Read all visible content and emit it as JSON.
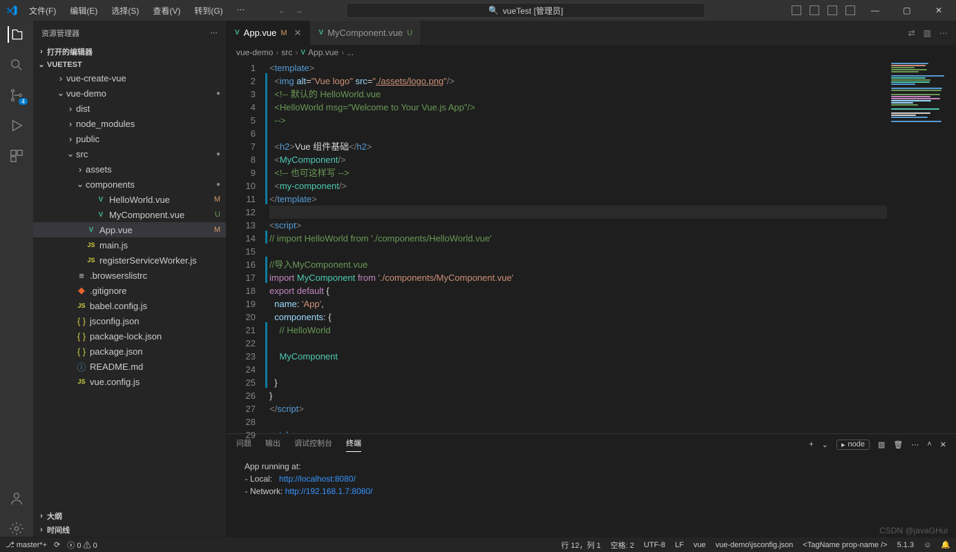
{
  "menus": [
    "文件(F)",
    "编辑(E)",
    "选择(S)",
    "查看(V)",
    "转到(G)"
  ],
  "search": {
    "text": "vueTest [管理员]"
  },
  "sidebar": {
    "title": "资源管理器",
    "openEditors": "打开的编辑器",
    "project": "VUETEST",
    "outline": "大纲",
    "timeline": "时间线",
    "tree": [
      {
        "ind": 2,
        "chev": "›",
        "type": "folder",
        "label": "vue-create-vue"
      },
      {
        "ind": 2,
        "chev": "⌄",
        "type": "folder",
        "label": "vue-demo",
        "dot": true
      },
      {
        "ind": 3,
        "chev": "›",
        "type": "folder",
        "label": "dist"
      },
      {
        "ind": 3,
        "chev": "›",
        "type": "folder",
        "label": "node_modules"
      },
      {
        "ind": 3,
        "chev": "›",
        "type": "folder",
        "label": "public"
      },
      {
        "ind": 3,
        "chev": "⌄",
        "type": "folder",
        "label": "src",
        "dot": true
      },
      {
        "ind": 4,
        "chev": "›",
        "type": "folder",
        "label": "assets"
      },
      {
        "ind": 4,
        "chev": "⌄",
        "type": "folder",
        "label": "components",
        "dot": true
      },
      {
        "ind": 5,
        "type": "vue",
        "label": "HelloWorld.vue",
        "badge": "M"
      },
      {
        "ind": 5,
        "type": "vue",
        "label": "MyComponent.vue",
        "badge": "U"
      },
      {
        "ind": 4,
        "type": "vue",
        "label": "App.vue",
        "badge": "M",
        "sel": true
      },
      {
        "ind": 4,
        "type": "js",
        "label": "main.js"
      },
      {
        "ind": 4,
        "type": "js",
        "label": "registerServiceWorker.js"
      },
      {
        "ind": 3,
        "type": "file",
        "label": ".browserslistrc"
      },
      {
        "ind": 3,
        "type": "git",
        "label": ".gitignore"
      },
      {
        "ind": 3,
        "type": "js",
        "label": "babel.config.js"
      },
      {
        "ind": 3,
        "type": "json",
        "label": "jsconfig.json"
      },
      {
        "ind": 3,
        "type": "json",
        "label": "package-lock.json"
      },
      {
        "ind": 3,
        "type": "json",
        "label": "package.json"
      },
      {
        "ind": 3,
        "type": "md",
        "label": "README.md"
      },
      {
        "ind": 3,
        "type": "js",
        "label": "vue.config.js"
      }
    ]
  },
  "tabs": [
    {
      "icon": "vue",
      "label": "App.vue",
      "mod": "M",
      "active": true,
      "close": true
    },
    {
      "icon": "vue",
      "label": "MyComponent.vue",
      "mod": "U"
    }
  ],
  "breadcrumb": [
    "vue-demo",
    "src",
    "App.vue",
    "..."
  ],
  "sc": {
    "badge": "4"
  },
  "code": {
    "lines": [
      1,
      2,
      3,
      4,
      5,
      6,
      7,
      8,
      9,
      10,
      11,
      12,
      13,
      14,
      15,
      16,
      17,
      18,
      19,
      20,
      21,
      22,
      23,
      24,
      25,
      26,
      27,
      28,
      29
    ],
    "mods": [
      0,
      1,
      1,
      1,
      1,
      1,
      1,
      1,
      1,
      1,
      1,
      0,
      0,
      1,
      0,
      1,
      1,
      0,
      0,
      0,
      1,
      1,
      1,
      1,
      1,
      0,
      0,
      0,
      0
    ]
  },
  "panel": {
    "tabs": [
      "问题",
      "输出",
      "调试控制台",
      "终端"
    ],
    "shell": "node",
    "term": {
      "l1": "  App running at:",
      "l2a": "  - Local:   ",
      "l2b": "http://localhost:8080/",
      "l3a": "  - Network: ",
      "l3b": "http://192.168.1.7:8080/"
    }
  },
  "status": {
    "branch": "master*+",
    "errors": "0",
    "warnings": "0",
    "pos": "行 12，列 1",
    "spaces": "空格: 2",
    "enc": "UTF-8",
    "eol": "LF",
    "lang": "vue",
    "ts": "vue-demo\\jsconfig.json",
    "tag": "<TagName prop-name />",
    "ver": "5.1.3"
  },
  "watermark": "CSDN @javaGHui"
}
